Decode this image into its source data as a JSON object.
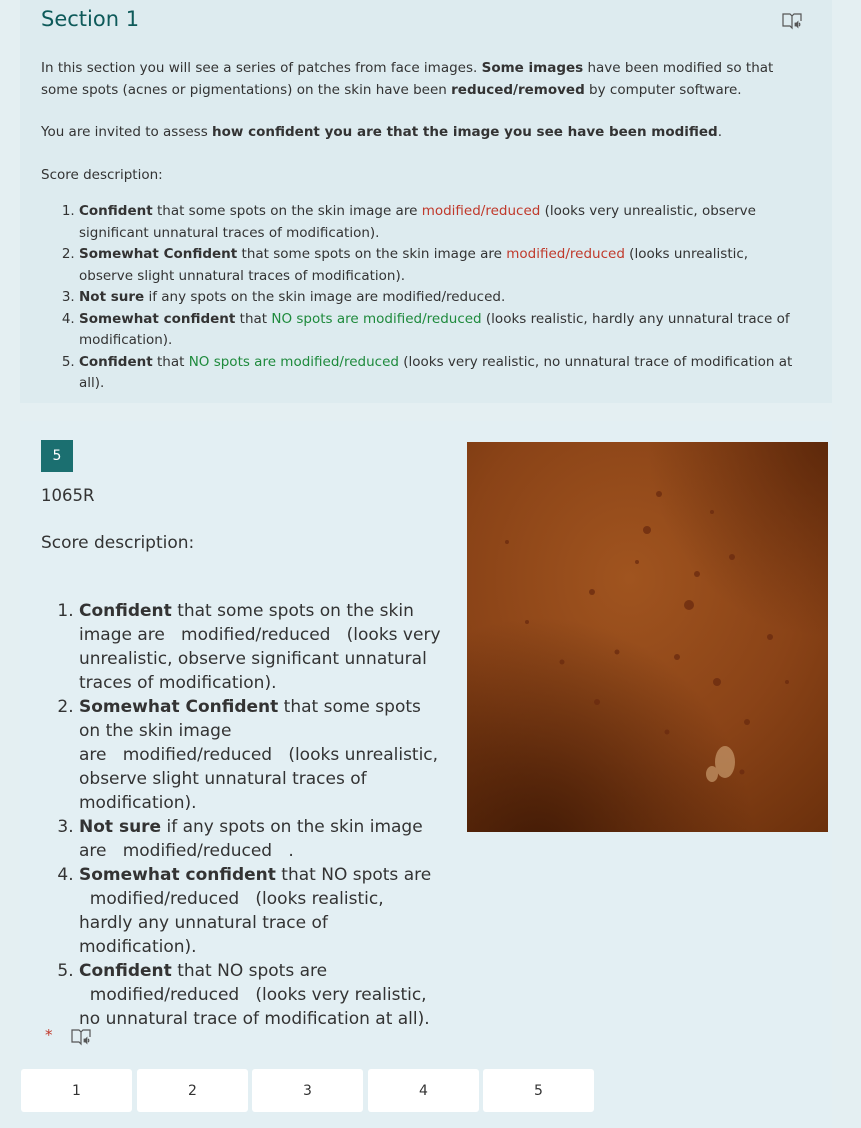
{
  "section": {
    "title": "Section 1",
    "intro_p1": [
      {
        "text": "In this section you will see a series of patches from face images. ",
        "style": ""
      },
      {
        "text": "Some images",
        "style": "b"
      },
      {
        "text": " have been modified so that some spots (acnes or pigmentations) on the skin have been ",
        "style": ""
      },
      {
        "text": "reduced/removed",
        "style": "b"
      },
      {
        "text": " by computer software.",
        "style": ""
      }
    ],
    "intro_p2": [
      {
        "text": "You are invited to assess ",
        "style": ""
      },
      {
        "text": "how confident you are that the image you see have been modified",
        "style": "b"
      },
      {
        "text": ".",
        "style": ""
      }
    ],
    "score_label": "Score description:",
    "scores": [
      [
        {
          "text": "Confident",
          "style": "b"
        },
        {
          "text": " that some spots on the skin image are ",
          "style": ""
        },
        {
          "text": "modified/reduced",
          "style": "red"
        },
        {
          "text": " (looks very unrealistic, observe significant unnatural traces of modification).",
          "style": ""
        }
      ],
      [
        {
          "text": "Somewhat Confident",
          "style": "b"
        },
        {
          "text": " that some spots on the skin image are ",
          "style": ""
        },
        {
          "text": "modified/reduced",
          "style": "red"
        },
        {
          "text": " (looks unrealistic, observe slight unnatural traces of modification).",
          "style": ""
        }
      ],
      [
        {
          "text": "Not sure",
          "style": "b"
        },
        {
          "text": " if any spots on the skin image are modified/reduced.",
          "style": ""
        }
      ],
      [
        {
          "text": "Somewhat confident",
          "style": "b"
        },
        {
          "text": " that ",
          "style": ""
        },
        {
          "text": "NO spots are modified/reduced",
          "style": "green"
        },
        {
          "text": " (looks realistic, hardly any unnatural trace of modification).",
          "style": ""
        }
      ],
      [
        {
          "text": "Confident",
          "style": "b"
        },
        {
          "text": " that ",
          "style": ""
        },
        {
          "text": "NO spots are modified/reduced",
          "style": "green"
        },
        {
          "text": " (looks very realistic, no unnatural trace of modification at all).",
          "style": ""
        }
      ]
    ]
  },
  "question": {
    "number": "5",
    "code": "1065R",
    "score_label": "Score description:",
    "scores": [
      [
        {
          "text": "Confident",
          "style": "b"
        },
        {
          "text": " that some spots on the skin image are   modified/reduced   (looks very unrealistic, observe significant unnatural traces of modification).",
          "style": ""
        }
      ],
      [
        {
          "text": "Somewhat Confident",
          "style": "b"
        },
        {
          "text": " that some spots on the skin image",
          "style": ""
        },
        {
          "text": "BR",
          "style": "br"
        },
        {
          "text": "are   modified/reduced   (looks unrealistic, observe slight unnatural traces of modification).",
          "style": ""
        }
      ],
      [
        {
          "text": "Not sure",
          "style": "b"
        },
        {
          "text": " if any spots on the skin image are   modified/reduced   .",
          "style": ""
        }
      ],
      [
        {
          "text": "Somewhat confident",
          "style": "b"
        },
        {
          "text": " that NO spots are   modified/reduced   (looks realistic, hardly any unnatural trace of modification).",
          "style": ""
        }
      ],
      [
        {
          "text": "Confident",
          "style": "b"
        },
        {
          "text": " that NO spots are   modified/reduced   (looks very realistic, no unnatural trace of modification at all).",
          "style": ""
        }
      ]
    ],
    "required_mark": "*",
    "choices": [
      "1",
      "2",
      "3",
      "4",
      "5"
    ]
  },
  "colors": {
    "accent": "#1b6f70",
    "title": "#0e5a5a",
    "modified_red": "#c0392b",
    "unmodified_green": "#1e8a3c"
  },
  "icons": {
    "reader": "immersive-reader-icon"
  }
}
